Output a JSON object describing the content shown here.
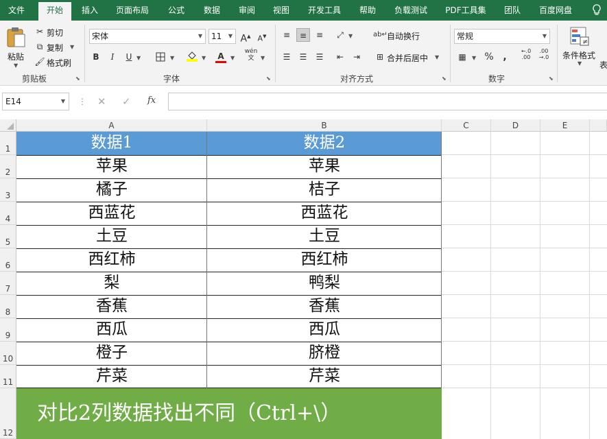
{
  "menu": {
    "tabs": [
      "文件",
      "开始",
      "插入",
      "页面布局",
      "公式",
      "数据",
      "审阅",
      "视图",
      "开发工具",
      "帮助",
      "负载测试",
      "PDF工具集",
      "团队",
      "百度网盘"
    ],
    "active": "开始",
    "lightbulb_icon": "lightbulb-icon"
  },
  "ribbon": {
    "clipboard": {
      "paste": "粘贴",
      "cut": "剪切",
      "copy": "复制",
      "format_painter": "格式刷",
      "label": "剪贴板"
    },
    "font": {
      "font_name": "宋体",
      "font_size": "11",
      "bold": "B",
      "italic": "I",
      "underline": "U",
      "grow": "A",
      "shrink": "A",
      "label": "字体",
      "phonetic": "wén"
    },
    "alignment": {
      "wrap_text": "自动换行",
      "merge_center": "合并后居中",
      "label": "对齐方式"
    },
    "number": {
      "format": "常规",
      "percent": "%",
      "comma": ",",
      "label": "数字",
      "inc_decimal": "←.0 .00",
      "dec_decimal": ".00 →.0"
    },
    "styles": {
      "conditional_format": "条件格式",
      "table_cut": "表"
    }
  },
  "formula_bar": {
    "name_box": "E14",
    "cancel": "✕",
    "enter": "✓",
    "fx": "fx",
    "value": ""
  },
  "sheet": {
    "columns": [
      "A",
      "B",
      "C",
      "D",
      "E"
    ],
    "rows": [
      "1",
      "2",
      "3",
      "4",
      "5",
      "6",
      "7",
      "8",
      "9",
      "10",
      "11",
      "12"
    ],
    "headers": [
      "数据1",
      "数据2"
    ],
    "data": [
      [
        "苹果",
        "苹果"
      ],
      [
        "橘子",
        "桔子"
      ],
      [
        "西蓝花",
        "西蓝花"
      ],
      [
        "土豆",
        "土豆"
      ],
      [
        "西红柿",
        "西红柿"
      ],
      [
        "梨",
        "鸭梨"
      ],
      [
        "香蕉",
        "香蕉"
      ],
      [
        "西瓜",
        "西瓜"
      ],
      [
        "橙子",
        "脐橙"
      ],
      [
        "芹菜",
        "芹菜"
      ]
    ],
    "banner": "对比2列数据找出不同（Ctrl+\\）",
    "header_fill": "#5b9bd5",
    "banner_fill": "#70ad47"
  }
}
